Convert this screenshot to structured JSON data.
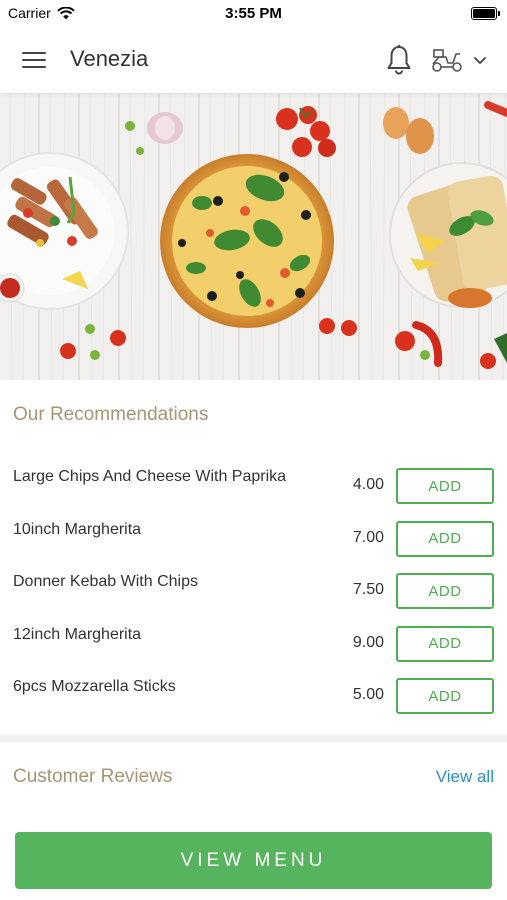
{
  "status_bar": {
    "carrier": "Carrier",
    "time": "3:55 PM",
    "icons": [
      "wifi-icon",
      "battery-icon"
    ]
  },
  "header": {
    "title": "Venezia",
    "icons": [
      "hamburger-menu-icon",
      "bell-icon",
      "delivery-scooter-icon",
      "chevron-down-icon"
    ]
  },
  "hero": {
    "image": "food-banner-pizza-kebab-wraps"
  },
  "recommendations": {
    "title": "Our Recommendations",
    "items": [
      {
        "name": "Large Chips And Cheese With Paprika",
        "price": "4.00",
        "action": "ADD"
      },
      {
        "name": "10inch Margherita",
        "price": "7.00",
        "action": "ADD"
      },
      {
        "name": "Donner Kebab With Chips",
        "price": "7.50",
        "action": "ADD"
      },
      {
        "name": "12inch Margherita",
        "price": "9.00",
        "action": "ADD"
      },
      {
        "name": "6pcs Mozzarella Sticks",
        "price": "5.00",
        "action": "ADD"
      }
    ]
  },
  "reviews": {
    "title": "Customer Reviews",
    "view_all": "View all"
  },
  "footer": {
    "view_menu": "VIEW MENU"
  },
  "colors": {
    "accent_green": "#57b45e",
    "section_title": "#a89576",
    "link_blue": "#2a8fc4"
  }
}
